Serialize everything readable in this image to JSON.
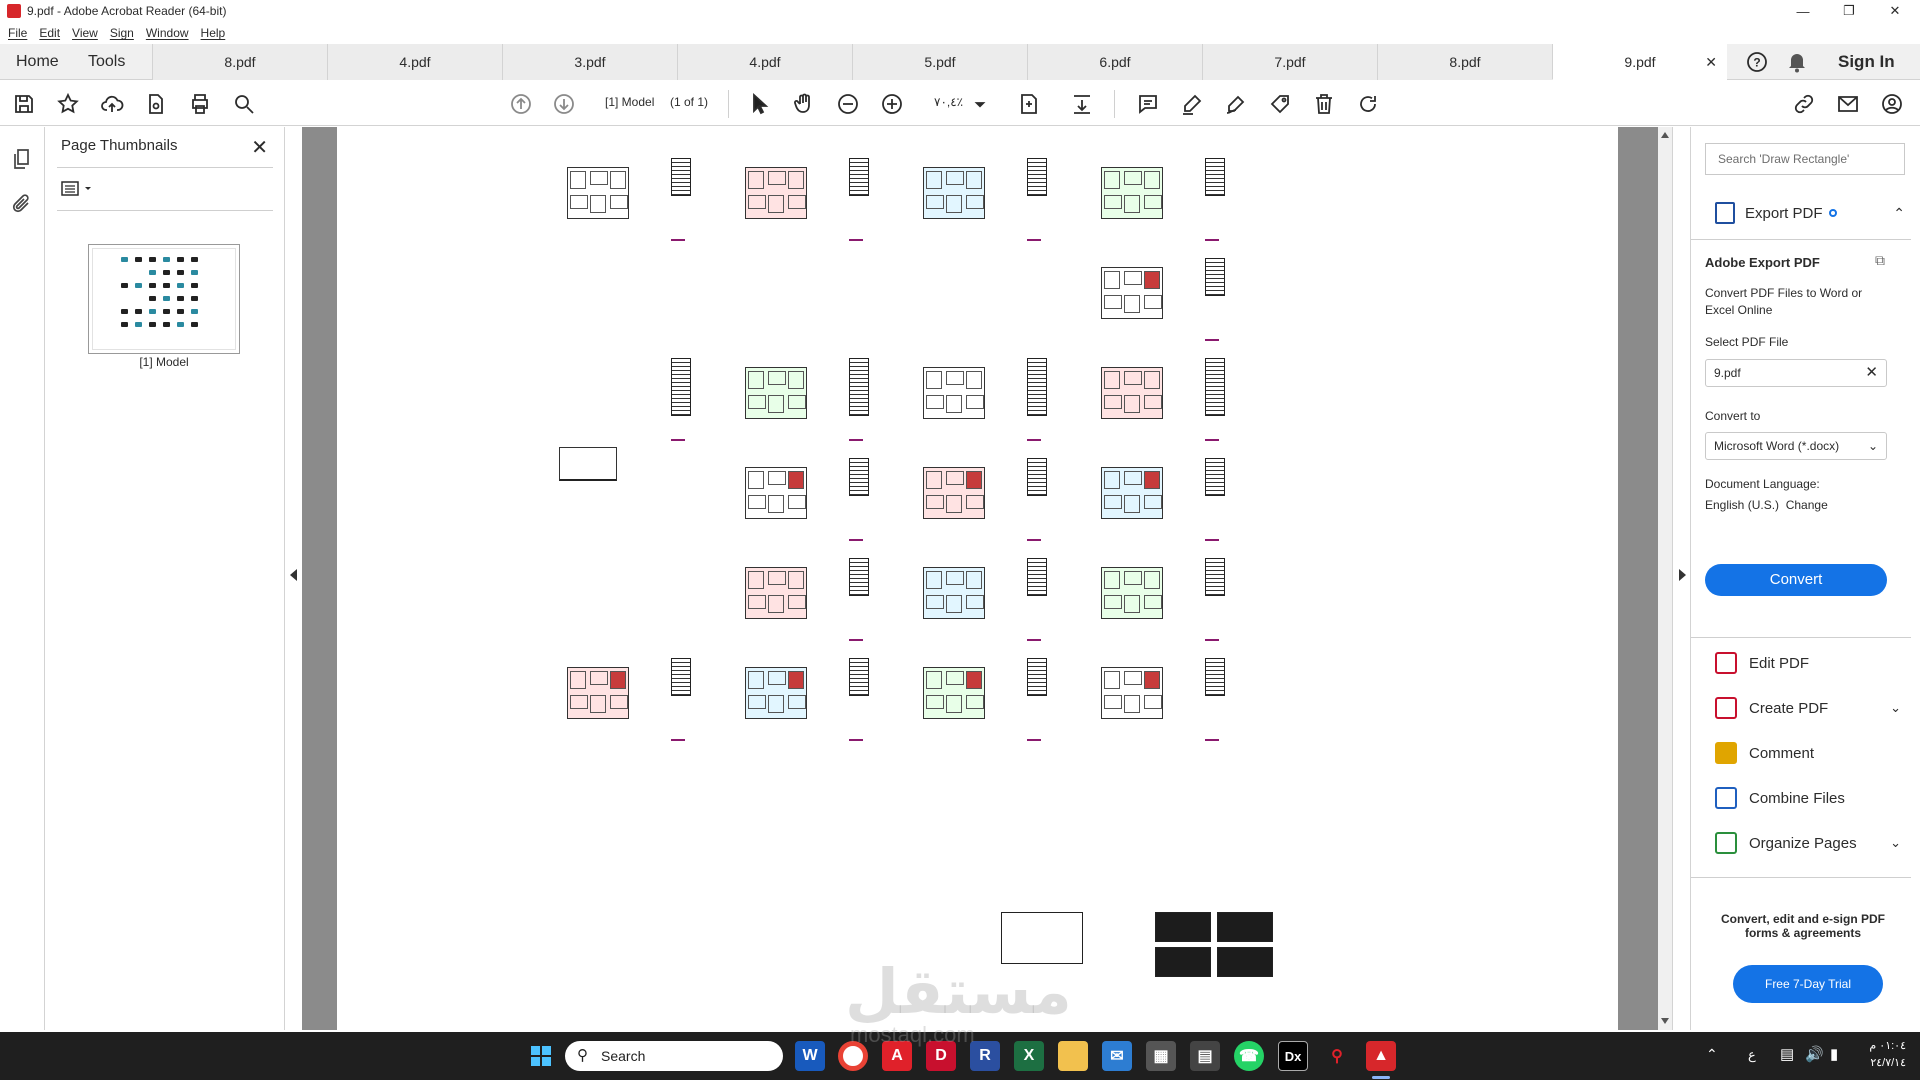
{
  "window": {
    "title": "9.pdf - Adobe Acrobat Reader (64-bit)"
  },
  "menu": [
    "File",
    "Edit",
    "View",
    "Sign",
    "Window",
    "Help"
  ],
  "nav": {
    "home": "Home",
    "tools": "Tools",
    "sign_in": "Sign In"
  },
  "tabs": [
    "8.pdf",
    "4.pdf",
    "3.pdf",
    "4.pdf",
    "5.pdf",
    "6.pdf",
    "7.pdf",
    "8.pdf",
    "9.pdf"
  ],
  "active_tab": "9.pdf",
  "toolbar": {
    "page_label": "[1] Model",
    "page_of": "(1 of 1)",
    "zoom": "٧٠,٤٪"
  },
  "thumbnails": {
    "title": "Page Thumbnails",
    "page_label": "[1] Model"
  },
  "right_pane": {
    "search_placeholder": "Search 'Draw Rectangle'",
    "export_header": "Export PDF",
    "section_title": "Adobe Export PDF",
    "description": "Convert PDF Files to Word or Excel Online",
    "select_label": "Select PDF File",
    "selected_file": "9.pdf",
    "convert_to_label": "Convert to",
    "convert_to_value": "Microsoft Word (*.docx)",
    "doc_language_label": "Document Language:",
    "doc_language_value": "English (U.S.)",
    "change_link": "Change",
    "convert_button": "Convert",
    "tools": [
      {
        "label": "Edit PDF",
        "icon": "edit-pdf-icon",
        "color": "#c8102e"
      },
      {
        "label": "Create PDF",
        "icon": "create-pdf-icon",
        "color": "#c8102e"
      },
      {
        "label": "Comment",
        "icon": "comment-icon",
        "color": "#e0a500"
      },
      {
        "label": "Combine Files",
        "icon": "combine-files-icon",
        "color": "#1f5fbf"
      },
      {
        "label": "Organize Pages",
        "icon": "organize-pages-icon",
        "color": "#2a8f3c"
      }
    ],
    "promo_text": "Convert, edit and e-sign PDF forms & agreements",
    "trial_button": "Free 7-Day Trial"
  },
  "taskbar": {
    "search": "Search",
    "time": "٠١:٠٤ م",
    "date": "٢٤/٧/١٤"
  },
  "watermark": {
    "text": "مستقل",
    "subtext": "mostaql.com"
  },
  "colors": {
    "accent": "#1473e6",
    "acrobat_red": "#d7272b",
    "taskbar": "#1f1f1f"
  }
}
